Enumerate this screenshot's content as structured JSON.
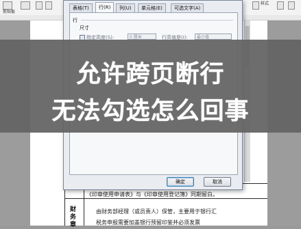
{
  "ribbon": {
    "top_left_text": "格式刷",
    "clipboard_label": "剪贴板",
    "right_text": "样式"
  },
  "dialog": {
    "tabs": [
      "表格(T)",
      "行(R)",
      "列(U)",
      "单元格(E)",
      "可选文字(A)"
    ],
    "row_group_label": "行",
    "size_label": "尺寸",
    "specify_height_label": "指定高度(S):",
    "height_value": "0 厘米",
    "row_height_label": "行高值是(I):",
    "row_height_value": "最小值",
    "ok_button": "确定",
    "cancel_button": "取消"
  },
  "document": {
    "row1_text": "《印章使用申请表》与《印章使用登记簿》同期留白。",
    "row2_text": "由财务部经理（或员责人）保管，主要用于银行汇",
    "row3_text": "税务申报需要加盖银行预留印鉴并必须发票",
    "side_label": "财务章"
  },
  "overlay": {
    "line1": "允许跨页断行",
    "line2": "无法勾选怎么回事"
  }
}
